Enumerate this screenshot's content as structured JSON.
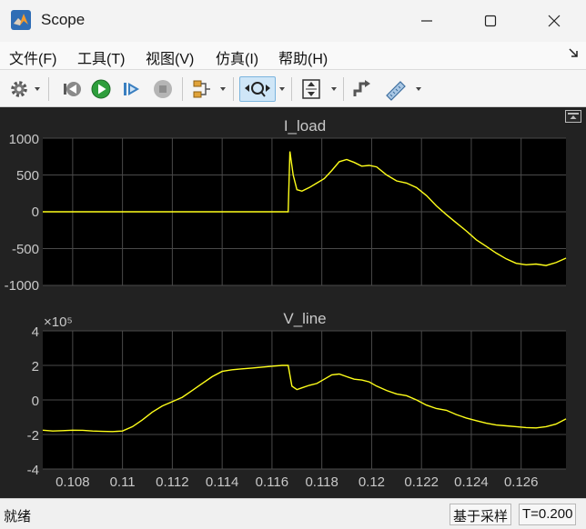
{
  "window": {
    "title": "Scope",
    "controls": [
      "minimize-icon",
      "maximize-icon",
      "close-icon"
    ]
  },
  "menubar": {
    "items": [
      {
        "label": "文件(F)"
      },
      {
        "label": "工具(T)"
      },
      {
        "label": "视图(V)"
      },
      {
        "label": "仿真(I)"
      },
      {
        "label": "帮助(H)"
      }
    ]
  },
  "toolbar": {
    "buttons": [
      "gear-icon",
      "step-back-icon",
      "run-icon",
      "step-forward-icon",
      "stop-icon",
      "signal-select-icon",
      "zoom-x-icon",
      "autoscale-icon",
      "triggers-icon",
      "measurements-icon"
    ]
  },
  "colors": {
    "plot_background": "#222222",
    "axes_background": "#000000",
    "grid": "#4a4a4a",
    "trace": "#ffff1a",
    "axis_text": "#c8c8c8"
  },
  "chart_data": [
    {
      "type": "line",
      "title": "I_load",
      "xlim": [
        0.1068,
        0.1278
      ],
      "ylim": [
        -1000,
        1000
      ],
      "yticks": [
        "1000",
        "500",
        "0",
        "-500",
        "-1000"
      ],
      "grid": true,
      "series": [
        {
          "x": [
            0.1068,
            0.1166,
            0.11665,
            0.11672,
            0.11685,
            0.117,
            0.1172,
            0.1175,
            0.1178,
            0.1181,
            0.1184,
            0.1187,
            0.119,
            0.1193,
            0.1196,
            0.1199,
            0.1202,
            0.1206,
            0.121,
            0.1214,
            0.1218,
            0.1222,
            0.1226,
            0.123,
            0.1234,
            0.1238,
            0.1242,
            0.1246,
            0.125,
            0.1254,
            0.1258,
            0.1262,
            0.1266,
            0.127,
            0.1274,
            0.1278
          ],
          "y": [
            0,
            0,
            0,
            820,
            500,
            300,
            280,
            330,
            390,
            450,
            560,
            680,
            710,
            670,
            620,
            630,
            610,
            500,
            420,
            390,
            330,
            220,
            80,
            -40,
            -150,
            -260,
            -380,
            -470,
            -560,
            -640,
            -700,
            -720,
            -710,
            -730,
            -690,
            -630
          ]
        }
      ]
    },
    {
      "type": "line",
      "title": "V_line",
      "exponent_label": "×10⁵",
      "xlim": [
        0.1068,
        0.1278
      ],
      "ylim": [
        -4,
        4
      ],
      "yticks": [
        "4",
        "2",
        "0",
        "-2",
        "-4"
      ],
      "xticks": [
        "0.108",
        "0.11",
        "0.112",
        "0.114",
        "0.116",
        "0.118",
        "0.12",
        "0.122",
        "0.124",
        "0.126"
      ],
      "grid": true,
      "series": [
        {
          "x": [
            0.1068,
            0.1072,
            0.1076,
            0.108,
            0.1084,
            0.1088,
            0.1092,
            0.1096,
            0.11,
            0.1104,
            0.1108,
            0.1112,
            0.1116,
            0.112,
            0.1124,
            0.1128,
            0.1132,
            0.1136,
            0.114,
            0.1144,
            0.1148,
            0.1152,
            0.1156,
            0.116,
            0.1164,
            0.11665,
            0.1168,
            0.117,
            0.1172,
            0.1175,
            0.1178,
            0.1181,
            0.1184,
            0.1187,
            0.119,
            0.1193,
            0.1196,
            0.1199,
            0.1202,
            0.1206,
            0.121,
            0.1214,
            0.1218,
            0.1222,
            0.1226,
            0.123,
            0.1234,
            0.1238,
            0.1242,
            0.1246,
            0.125,
            0.1254,
            0.1258,
            0.1262,
            0.1266,
            0.127,
            0.1274,
            0.1278
          ],
          "y": [
            -1.75,
            -1.8,
            -1.78,
            -1.75,
            -1.76,
            -1.8,
            -1.82,
            -1.83,
            -1.8,
            -1.55,
            -1.15,
            -0.7,
            -0.35,
            -0.1,
            0.15,
            0.55,
            0.95,
            1.35,
            1.65,
            1.75,
            1.8,
            1.85,
            1.9,
            1.95,
            2.0,
            2.0,
            0.8,
            0.6,
            0.7,
            0.85,
            0.95,
            1.2,
            1.45,
            1.5,
            1.35,
            1.2,
            1.15,
            1.05,
            0.8,
            0.55,
            0.35,
            0.25,
            0.0,
            -0.3,
            -0.5,
            -0.6,
            -0.85,
            -1.05,
            -1.2,
            -1.35,
            -1.45,
            -1.5,
            -1.55,
            -1.6,
            -1.62,
            -1.55,
            -1.4,
            -1.1
          ]
        }
      ]
    }
  ],
  "statusbar": {
    "text": "就绪",
    "sample_mode": "基于采样",
    "time": "T=0.200"
  }
}
